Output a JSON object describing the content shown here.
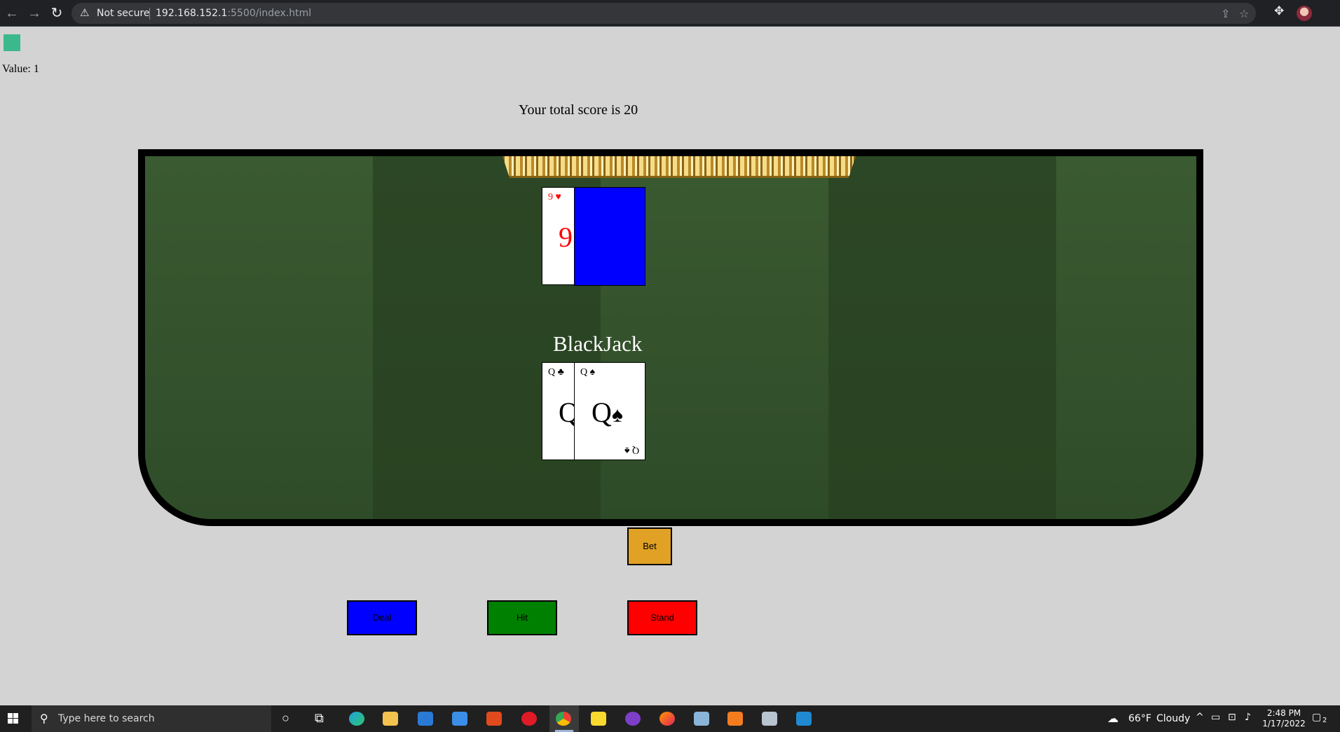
{
  "browser": {
    "back_icon": "arrow-left-icon",
    "forward_icon": "arrow-right-icon",
    "reload_icon": "reload-icon",
    "security_icon": "warning-triangle-icon",
    "security_label": "Not secure",
    "url_host": "192.168.152.1",
    "url_path": ":5500/index.html",
    "share_icon": "share-icon",
    "bookmark_icon": "star-icon",
    "extensions_icon": "puzzle-icon",
    "profile_icon": "avatar"
  },
  "page": {
    "value_label": "Value: 1",
    "score_text": "Your total score is 20",
    "chip_color": "#3cb98c"
  },
  "table": {
    "title": "BlackJack",
    "felt_color": "#2f4c27",
    "dealer_cards": [
      {
        "rank": "9",
        "suit": "♥",
        "color": "red",
        "face_up": true
      },
      {
        "face_up": false,
        "back_color": "#0000ff"
      }
    ],
    "player_cards": [
      {
        "rank": "Q",
        "suit": "♣",
        "color": "black"
      },
      {
        "rank": "Q",
        "suit": "♠",
        "color": "black"
      }
    ]
  },
  "buttons": {
    "bet": "Bet",
    "deal": "Deal",
    "hit": "Hit",
    "stand": "Stand"
  },
  "taskbar": {
    "search_placeholder": "Type here to search",
    "weather_temp": "66°F",
    "weather_desc": "Cloudy",
    "time": "2:48 PM",
    "date": "1/17/2022",
    "notifications": "2"
  }
}
